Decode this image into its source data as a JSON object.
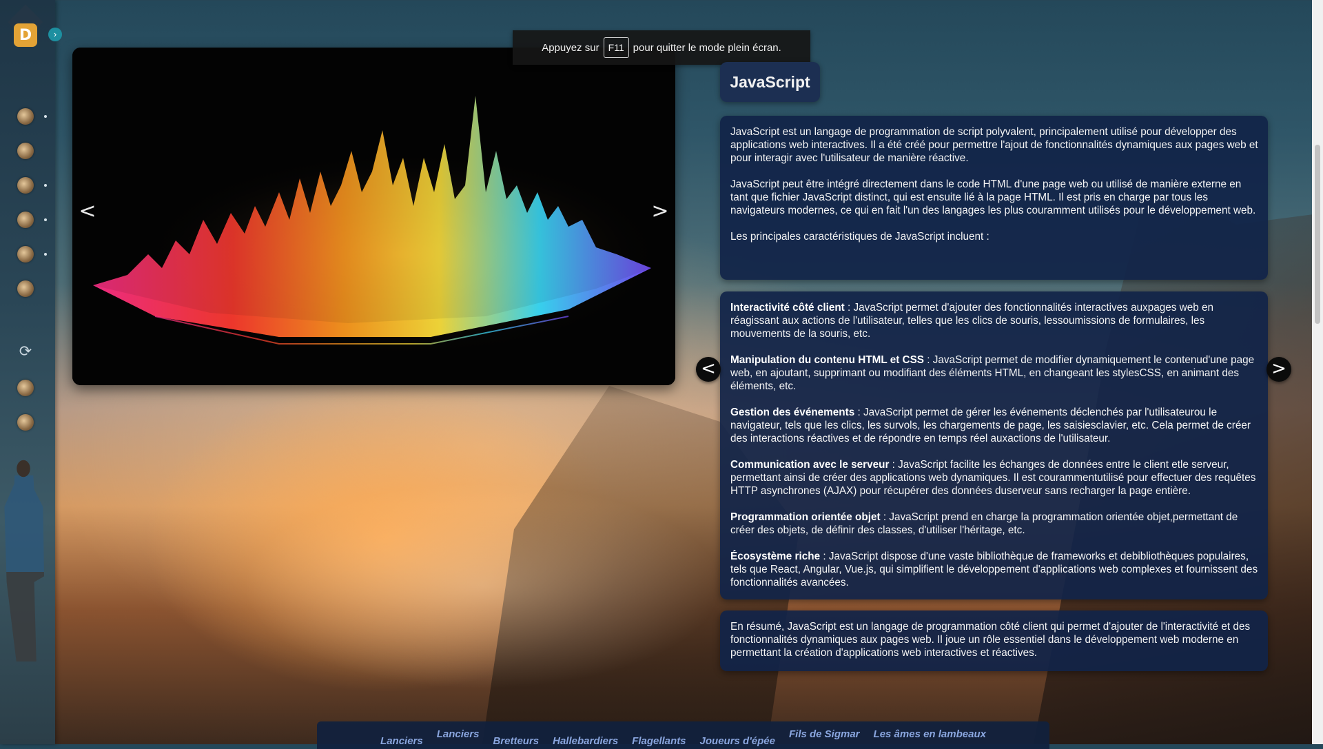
{
  "sidebar": {
    "logo_letter": "D",
    "expand_icon": "chevron-right-icon",
    "items": [
      {
        "icon": "warrior-avatar-icon",
        "has_dot": true
      },
      {
        "icon": "warrior-avatar-icon",
        "has_dot": false
      },
      {
        "icon": "warrior-avatar-icon",
        "has_dot": true
      },
      {
        "icon": "warrior-avatar-icon",
        "has_dot": true
      },
      {
        "icon": "warrior-avatar-icon",
        "has_dot": true
      },
      {
        "icon": "warrior-avatar-icon",
        "has_dot": false
      }
    ],
    "refresh_icon": "refresh-icon",
    "lower_items": [
      {
        "icon": "warrior-avatar-icon"
      },
      {
        "icon": "warrior-avatar-icon"
      }
    ]
  },
  "fullscreen_notice": {
    "before": "Appuyez sur",
    "key": "F11",
    "after": "pour quitter le mode plein écran."
  },
  "carousel": {
    "prev_label": "<",
    "next_label": ">"
  },
  "article": {
    "title": "JavaScript",
    "intro": [
      "JavaScript est un langage de programmation de script polyvalent, principalement utilisé pour développer des applications web interactives. Il a été créé pour permettre l'ajout de fonctionnalités dynamiques aux pages web et pour interagir avec l'utilisateur de manière réactive.",
      "JavaScript peut être intégré directement dans le code HTML d'une page web ou utilisé de manière externe en tant que fichier JavaScript distinct, qui est ensuite lié à la page HTML. Il est pris en charge par tous les navigateurs modernes, ce qui en fait l'un des langages les plus couramment utilisés pour le développement web.",
      "Les principales caractéristiques de JavaScript incluent :"
    ],
    "features": [
      {
        "term": "Interactivité côté client",
        "text": " : JavaScript permet d'ajouter des fonctionnalités interactives auxpages web en réagissant aux actions de l'utilisateur, telles que les clics de souris, lessoumissions de formulaires, les mouvements de la souris, etc."
      },
      {
        "term": "Manipulation du contenu HTML et CSS",
        "text": " : JavaScript permet de modifier dynamiquement le contenud'une page web, en ajoutant, supprimant ou modifiant des éléments HTML, en changeant les stylesCSS, en animant des éléments, etc."
      },
      {
        "term": "Gestion des événements",
        "text": " : JavaScript permet de gérer les événements déclenchés par l'utilisateurou le navigateur, tels que les clics, les survols, les chargements de page, les saisiesclavier, etc. Cela permet de créer des interactions réactives et de répondre en temps réel auxactions de l'utilisateur."
      },
      {
        "term": "Communication avec le serveur",
        "text": " : JavaScript facilite les échanges de données entre le client etle serveur, permettant ainsi de créer des applications web dynamiques. Il est courammentutilisé pour effectuer des requêtes HTTP asynchrones (AJAX) pour récupérer des données duserveur sans recharger la page entière."
      },
      {
        "term": "Programmation orientée objet",
        "text": " : JavaScript prend en charge la programmation orientée objet,permettant de créer des objets, de définir des classes, d'utiliser l'héritage, etc."
      },
      {
        "term": "Écosystème riche",
        "text": " : JavaScript dispose d'une vaste bibliothèque de frameworks et debibliothèques populaires, tels que React, Angular, Vue.js, qui simplifient le développement d'applications web complexes et fournissent des fonctionnalités avancées."
      }
    ],
    "features_prev": "<",
    "features_next": ">",
    "summary": "En résumé, JavaScript est un langage de programmation côté client qui permet d'ajouter de l'interactivité et des fonctionnalités dynamiques aux pages web. Il joue un rôle essentiel dans le développement web moderne en permettant la création d'applications web interactives et réactives."
  },
  "bottom_nav": [
    "Lanciers",
    "Lanciers",
    "Bretteurs",
    "Hallebardiers",
    "Flagellants",
    "Joueurs d'épée",
    "Fils de Sigmar",
    "Les âmes en lambeaux"
  ],
  "colors": {
    "panel_bg": "#112448",
    "title_bg": "#1c2f52",
    "nav_text": "#8aa6df",
    "logo_badge": "#e3a336",
    "expand_btn": "#1d8fa0"
  }
}
